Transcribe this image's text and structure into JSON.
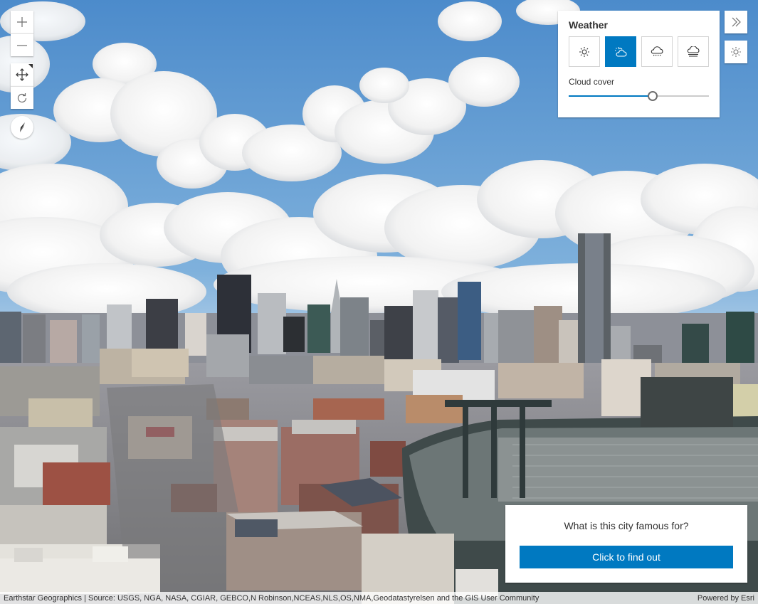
{
  "navigation": {
    "zoom_in_icon": "plus-icon",
    "zoom_out_icon": "minus-icon",
    "pan_icon": "move-arrows-icon",
    "rotate_icon": "rotate-icon",
    "compass_icon": "compass-icon"
  },
  "right_toolbar": {
    "collapse_icon": "double-chevron-right-icon",
    "daylight_icon": "sun-icon"
  },
  "weather": {
    "title": "Weather",
    "types": [
      {
        "name": "sunny",
        "icon": "sun-icon",
        "selected": false
      },
      {
        "name": "cloudy",
        "icon": "cloud-sun-icon",
        "selected": true
      },
      {
        "name": "rainy",
        "icon": "rain-cloud-icon",
        "selected": false
      },
      {
        "name": "foggy",
        "icon": "fog-cloud-icon",
        "selected": false
      }
    ],
    "cloud_cover_label": "Cloud cover",
    "cloud_cover_value": 0.6
  },
  "card": {
    "question": "What is this city famous for?",
    "button_label": "Click to find out"
  },
  "attribution": {
    "sources": "Earthstar Geographics | Source: USGS, NGA, NASA, CGIAR, GEBCO,N Robinson,NCEAS,NLS,OS,NMA,Geodatastyrelsen and the GIS User Community",
    "powered_by": "Powered by Esri"
  },
  "colors": {
    "accent": "#0079c1",
    "sky_top": "#4f8fcd",
    "sky_bottom": "#b7d3ec",
    "cloud": "#ffffff"
  }
}
